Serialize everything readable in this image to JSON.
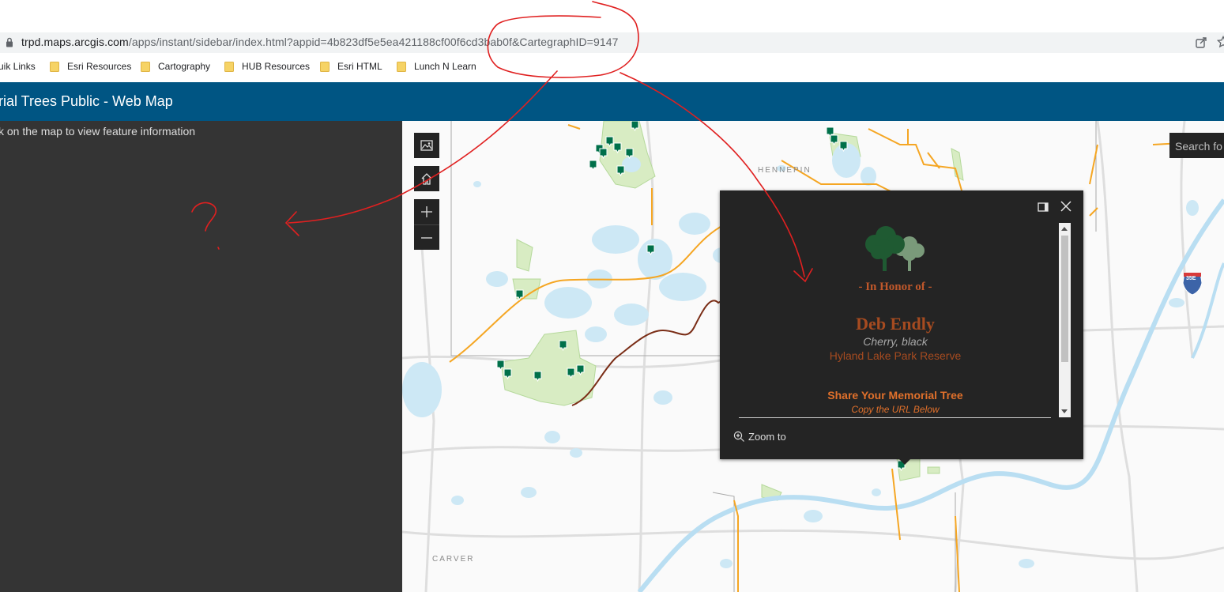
{
  "browser": {
    "url_domain": "trpd.maps.arcgis.com",
    "url_path": "/apps/instant/sidebar/index.html?appid=4b823df5e5ea421188cf00f6cd3bab0f&CartegraphID=9147",
    "bookmarks": [
      {
        "label": "uik Links",
        "icon": "none"
      },
      {
        "label": "Esri Resources",
        "icon": "folder-icon"
      },
      {
        "label": "Cartography",
        "icon": "folder-icon"
      },
      {
        "label": "HUB Resources",
        "icon": "folder-icon"
      },
      {
        "label": "Esri HTML",
        "icon": "folder-icon"
      },
      {
        "label": "Lunch N Learn",
        "icon": "folder-icon"
      }
    ],
    "folder_color": "#f6d365"
  },
  "app": {
    "title": "rial Trees Public - Web Map",
    "header_color": "#005583"
  },
  "sidebar": {
    "hint": "k on the map to view feature information"
  },
  "map": {
    "search_placeholder": "Search fo",
    "county_labels": {
      "hennepin": "HENNEPIN",
      "carver": "CARVER"
    },
    "highway_shield": "35E",
    "controls": [
      "basemap-gallery-icon",
      "home-icon",
      "zoom-in-icon",
      "zoom-out-icon"
    ]
  },
  "popup": {
    "honor_label": "- In Honor of -",
    "honoree": "Deb Endly",
    "species": "Cherry, black",
    "park": "Hyland Lake Park Reserve",
    "share_title": "Share Your Memorial Tree",
    "share_subtitle": "Copy the URL Below",
    "zoom_to_label": "Zoom to",
    "accent_color": "#e0702b"
  },
  "annotation": {
    "question_mark": "?",
    "ink_color": "#e02020"
  }
}
